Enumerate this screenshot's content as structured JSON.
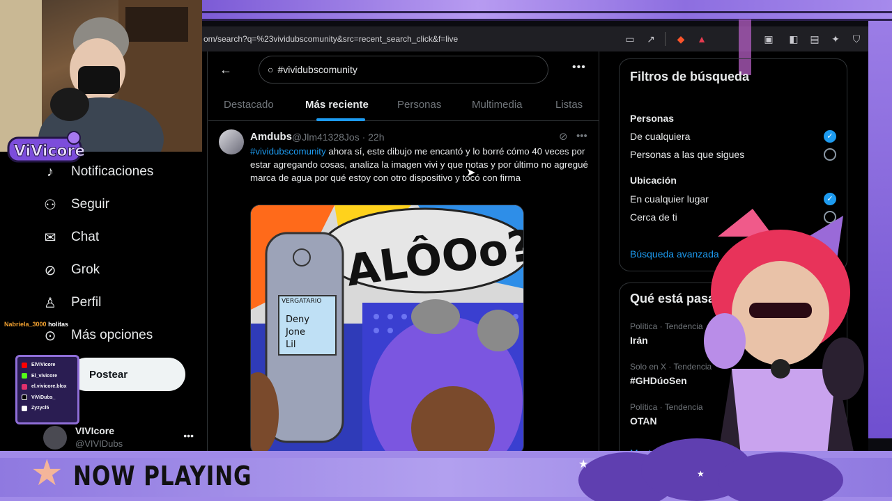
{
  "browser": {
    "url": "om/search?q=%23vividubscomunity&src=recent_search_click&f=live"
  },
  "left_nav": {
    "items": [
      {
        "label": "Notificaciones",
        "icon": "bell-icon"
      },
      {
        "label": "Seguir",
        "icon": "person-plus-icon"
      },
      {
        "label": "Chat",
        "icon": "envelope-icon"
      },
      {
        "label": "Grok",
        "icon": "grok-icon"
      },
      {
        "label": "Perfil",
        "icon": "person-icon"
      },
      {
        "label": "Más opciones",
        "icon": "more-circle-icon"
      }
    ],
    "post_button": "Postear",
    "account": {
      "name": "VIVIcore",
      "handle": "@VIVIDubs"
    }
  },
  "search": {
    "query": "#vividubscomunity"
  },
  "tabs": [
    "Destacado",
    "Más reciente",
    "Personas",
    "Multimedia",
    "Listas"
  ],
  "active_tab": "Más reciente",
  "tweet": {
    "name": "Amdubs",
    "handle_time": "@Jlm41328Jos · 22h",
    "hashtag": "#vividubscomunity",
    "text": " ahora sí, este dibujo me encantó y lo borré cómo 40 veces por estar agregando cosas, analiza la imagen vivi y que notas y por último no agregué marca de agua por qué estoy con otro dispositivo y tocó con firma",
    "image": {
      "speech_bubble": "ALÔOo?",
      "phone_screen_title": "VERGATARIO",
      "phone_contacts": [
        "Deny",
        "Jone",
        "Lil"
      ]
    }
  },
  "filters": {
    "title": "Filtros de búsqueda",
    "people_title": "Personas",
    "people_options": [
      "De cualquiera",
      "Personas a las que sigues"
    ],
    "location_title": "Ubicación",
    "location_options": [
      "En cualquier lugar",
      "Cerca de ti"
    ],
    "advanced": "Búsqueda avanzada"
  },
  "trends": {
    "title": "Qué está pasando",
    "items": [
      {
        "context": "Política · Tendencia",
        "name": "Irán"
      },
      {
        "context": "Solo en X · Tendencia",
        "name": "#GHDúoSen"
      },
      {
        "context": "Política · Tendencia",
        "name": "OTAN"
      }
    ],
    "show_more": "Mostrar más"
  },
  "overlay": {
    "logo": "ViVicore",
    "chat": {
      "user": "Nabriela_3000",
      "message": "holitas"
    },
    "socials": [
      {
        "label": "ElViVicore",
        "color": "#ff0000"
      },
      {
        "label": "El_vivicore",
        "color": "#53fc18"
      },
      {
        "label": "el.vivicore.blox",
        "color": "#e1306c"
      },
      {
        "label": "ViViDubs_",
        "color": "#000000"
      },
      {
        "label": "Zyzycl5",
        "color": "#ffffff"
      }
    ],
    "now_playing": "NOW PLAYING"
  }
}
